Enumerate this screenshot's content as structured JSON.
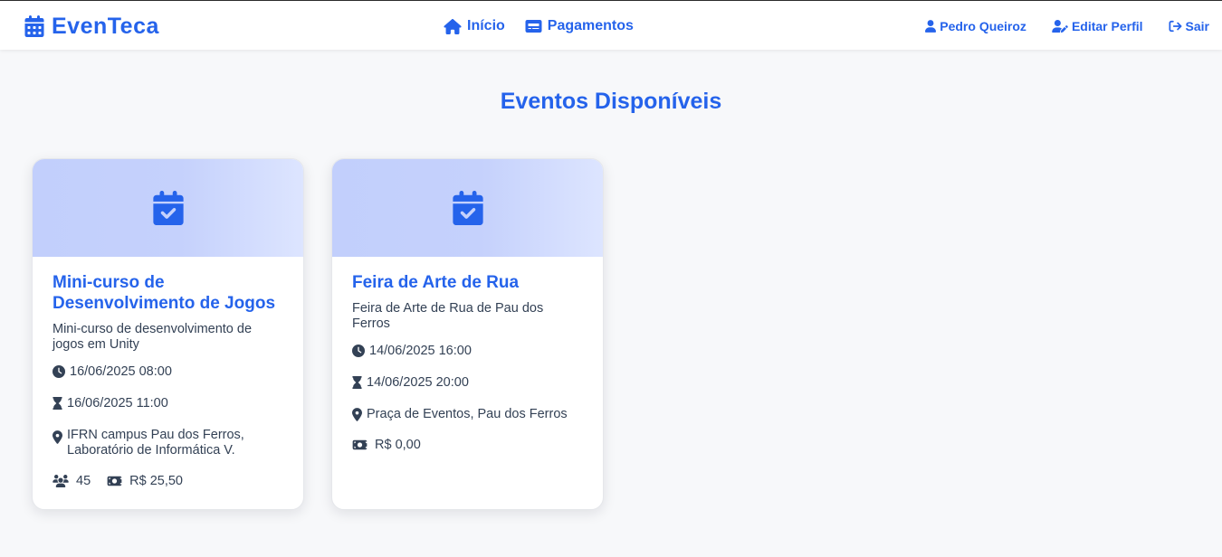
{
  "app": {
    "name": "EvenTeca"
  },
  "nav": {
    "home": "Início",
    "payments": "Pagamentos",
    "user": "Pedro Queiroz",
    "edit_profile": "Editar Perfil",
    "logout": "Sair"
  },
  "page": {
    "title": "Eventos Disponíveis"
  },
  "colors": {
    "accent": "#2563eb",
    "banner": "#c5d1fc",
    "text": "#334155"
  },
  "events": [
    {
      "title": "Mini-curso de Desenvolvimento de Jogos",
      "description": "Mini-curso de desenvolvimento de jogos em Unity",
      "start": "16/06/2025 08:00",
      "end": "16/06/2025 11:00",
      "location": "IFRN campus Pau dos Ferros, Laboratório de Informática V.",
      "capacity": "45",
      "price": "R$ 25,50"
    },
    {
      "title": "Feira de Arte de Rua",
      "description": "Feira de Arte de Rua de Pau dos Ferros",
      "start": "14/06/2025 16:00",
      "end": "14/06/2025 20:00",
      "location": "Praça de Eventos, Pau dos Ferros",
      "price": "R$ 0,00"
    }
  ]
}
